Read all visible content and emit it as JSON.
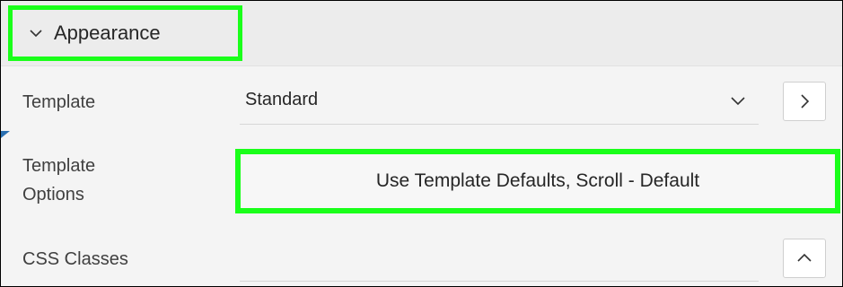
{
  "section": {
    "title": "Appearance",
    "toggle_icon": "chevron-down-icon"
  },
  "template": {
    "label": "Template",
    "value": "Standard",
    "dropdown_icon": "chevron-down-icon",
    "open_icon": "chevron-right-icon"
  },
  "template_options": {
    "label_line1": "Template",
    "label_line2": "Options",
    "value": "Use Template Defaults, Scroll - Default"
  },
  "css_classes": {
    "label": "CSS Classes",
    "value": "",
    "expand_icon": "chevron-up-icon"
  },
  "colors": {
    "highlight": "#1aff1a",
    "marker": "#2a6fb0",
    "background": "#f4f4f4",
    "header_background": "#ececec"
  }
}
